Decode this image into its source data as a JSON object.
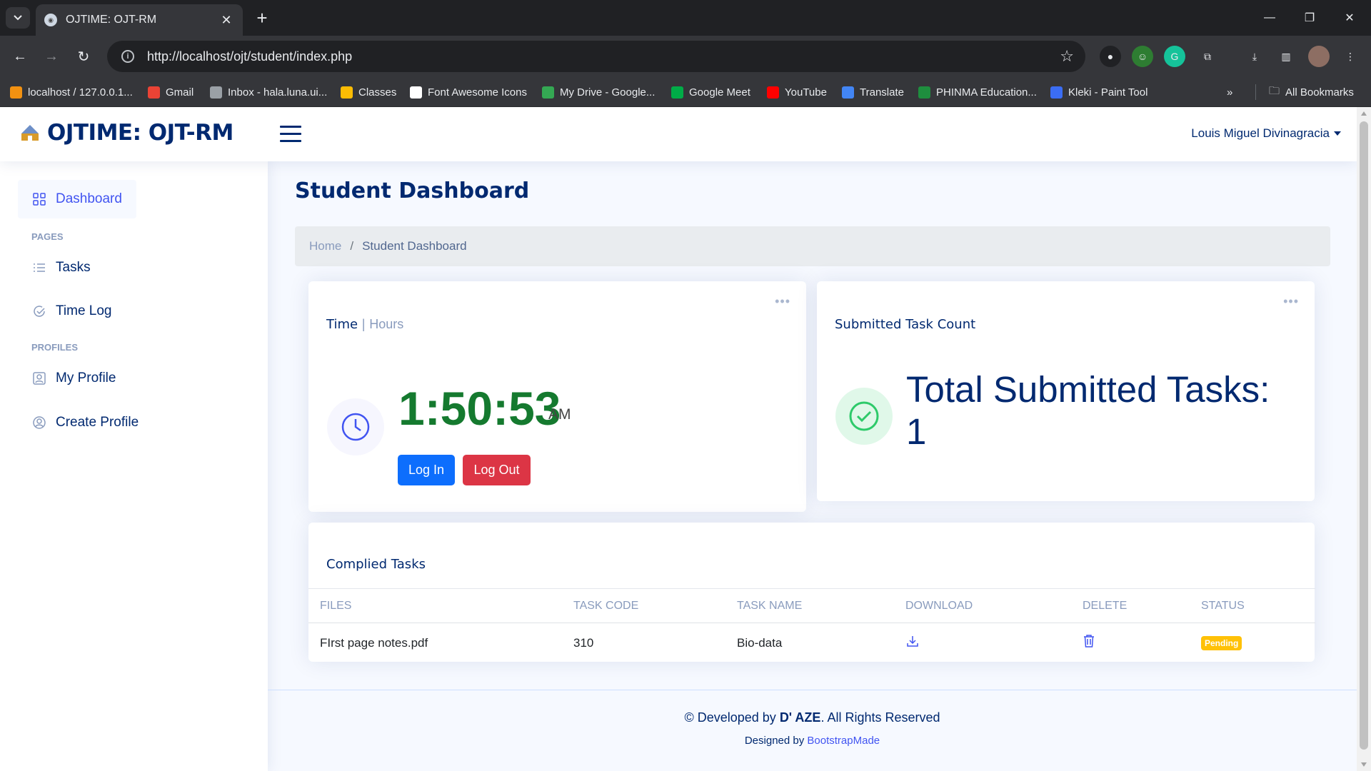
{
  "browser": {
    "tab_title": "OJTIME: OJT-RM",
    "url": "http://localhost/ojt/student/index.php",
    "bookmarks": [
      {
        "label": "localhost / 127.0.0.1...",
        "color": "#f29111"
      },
      {
        "label": "Gmail",
        "color": "#ea4335"
      },
      {
        "label": "Inbox - hala.luna.ui...",
        "color": "#9aa0a6"
      },
      {
        "label": "Classes",
        "color": "#fbbc04"
      },
      {
        "label": "Font Awesome Icons",
        "color": "#ffffff"
      },
      {
        "label": "My Drive - Google...",
        "color": "#34a853"
      },
      {
        "label": "Google Meet",
        "color": "#00ac47"
      },
      {
        "label": "YouTube",
        "color": "#ff0000"
      },
      {
        "label": "Translate",
        "color": "#4285f4"
      },
      {
        "label": "PHINMA Education...",
        "color": "#1e8e3e"
      },
      {
        "label": "Kleki - Paint Tool",
        "color": "#3b6df3"
      }
    ],
    "all_bookmarks": "All Bookmarks"
  },
  "header": {
    "logo_text": "OJTIME: OJT-RM",
    "user_name": "Louis Miguel Divinagracia"
  },
  "sidebar": {
    "dashboard": "Dashboard",
    "heading_pages": "Pages",
    "tasks": "Tasks",
    "time_log": "Time Log",
    "heading_profiles": "Profiles",
    "my_profile": "My Profile",
    "create_profile": "Create Profile"
  },
  "main": {
    "page_title": "Student Dashboard",
    "breadcrumb_home": "Home",
    "breadcrumb_sep": "/",
    "breadcrumb_current": "Student Dashboard"
  },
  "time_card": {
    "title": "Time",
    "sep": "|",
    "subtitle": "Hours",
    "time": "1:50:53",
    "ampm": "AM",
    "login_label": "Log In",
    "logout_label": "Log Out"
  },
  "task_card": {
    "title": "Submitted Task Count",
    "total_text": "Total Submitted Tasks: 1"
  },
  "complied": {
    "title": "Complied Tasks",
    "columns": [
      "FILES",
      "TASK CODE",
      "TASK NAME",
      "DOWNLOAD",
      "DELETE",
      "STATUS"
    ],
    "rows": [
      {
        "file": "FIrst page notes.pdf",
        "code": "310",
        "name": "Bio-data",
        "status": "Pending"
      }
    ]
  },
  "footer": {
    "copy_prefix": "© Developed by ",
    "developer": "D' AZE",
    "copy_suffix": ". All Rights Reserved",
    "designed_by": "Designed by ",
    "designer": "BootstrapMade"
  },
  "colors": {
    "primary": "#012970",
    "accent": "#4154f1",
    "clock_green": "#157a2f",
    "login_blue": "#0d6efd",
    "logout_red": "#dc3545",
    "pending_yellow": "#ffc107"
  }
}
